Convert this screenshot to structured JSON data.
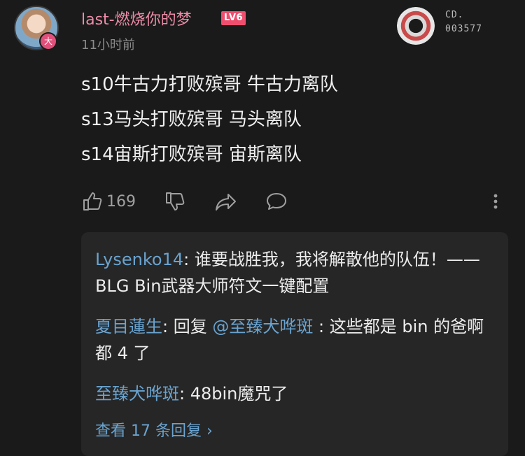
{
  "comment": {
    "username": "last-燃烧你的梦",
    "level": "LV6",
    "avatar_badge": "大",
    "time": "11小时前",
    "medal_text": [
      "CD.",
      "003577"
    ],
    "lines": [
      "s10牛古力打败殡哥 牛古力离队",
      "s13马头打败殡哥 马头离队",
      "s14宙斯打败殡哥 宙斯离队"
    ],
    "like_count": "169"
  },
  "icons": {
    "like": "thumbs-up-icon",
    "dislike": "thumbs-down-icon",
    "share": "share-icon",
    "reply": "comment-icon",
    "more": "more-vertical-icon"
  },
  "replies": {
    "items": [
      {
        "name": "Lysenko14",
        "sep": ": ",
        "text": "谁要战胜我，我将解散他的队伍！—— BLG Bin武器大师符文一键配置"
      },
      {
        "name": "夏目蓮生",
        "sep": ": ",
        "prefix": "回复 ",
        "mention": "@至臻犬哗斑",
        "text": " : 这些都是 bin 的爸啊都 4 了"
      },
      {
        "name": "至臻犬哗斑",
        "sep": ": ",
        "text": "48bin魔咒了"
      }
    ],
    "view_more": "查看 17 条回复 ›"
  },
  "colors": {
    "background": "#1a1a1a",
    "username": "#ee8ca8",
    "level_badge": "#f04e6e",
    "link_blue": "#6aa3cf",
    "reply_panel": "#262626"
  }
}
